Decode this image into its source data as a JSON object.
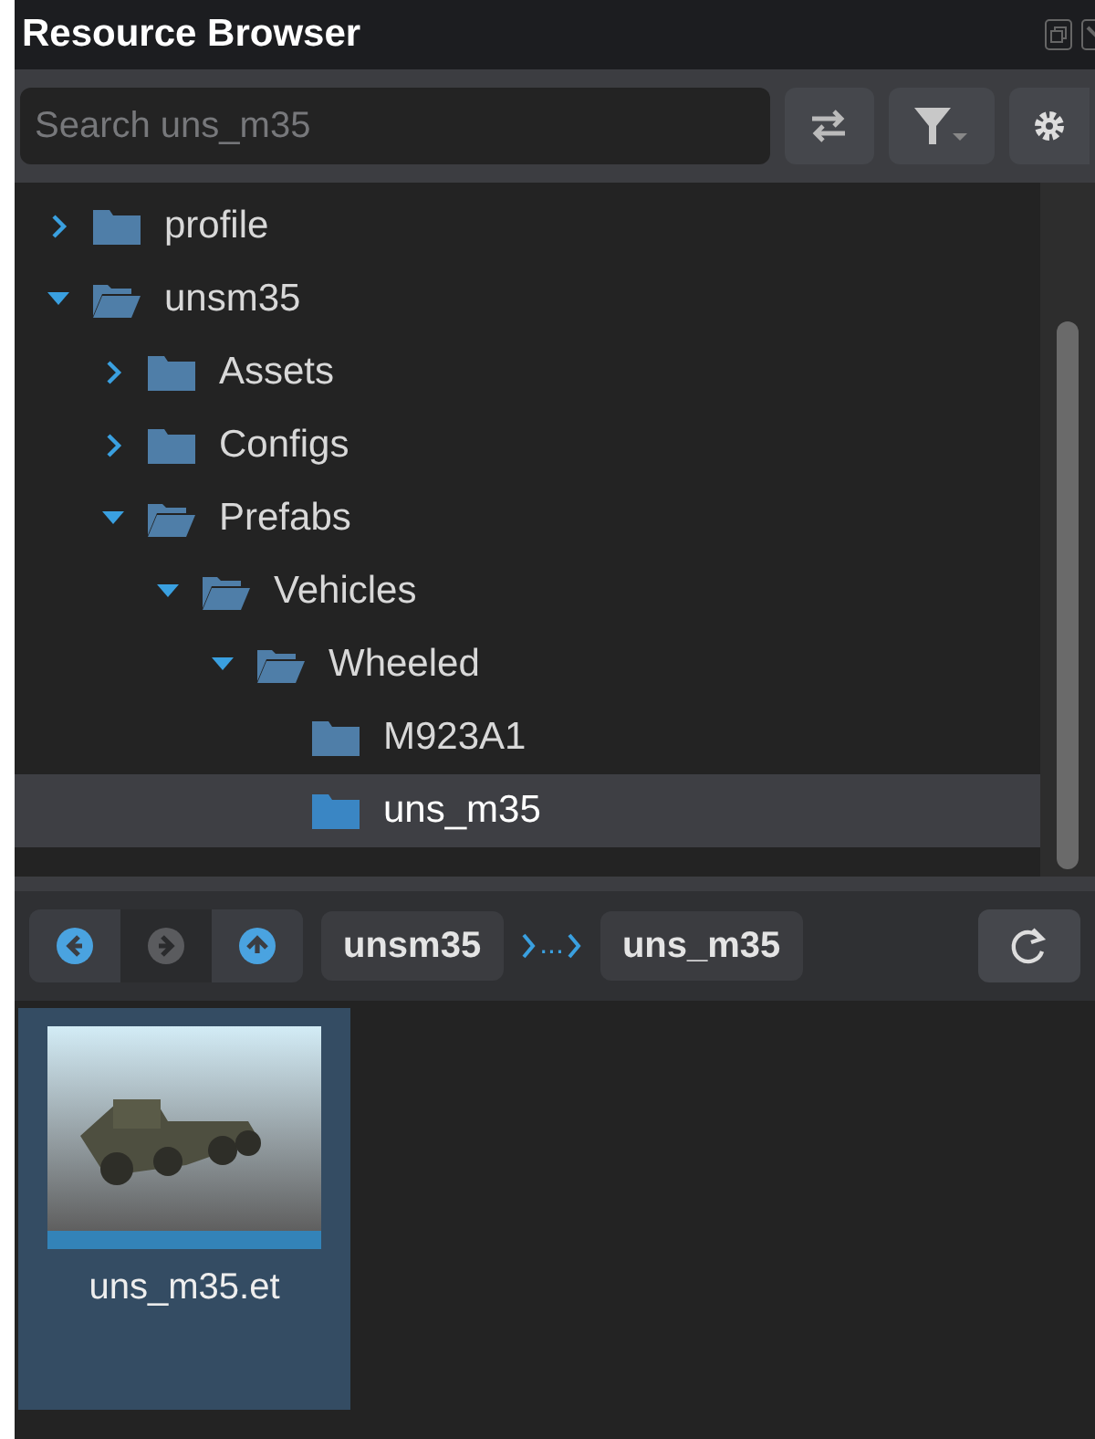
{
  "window": {
    "title": "Resource Browser"
  },
  "search": {
    "placeholder": "Search uns_m35"
  },
  "tree": [
    {
      "label": "profile",
      "expanded": false,
      "selected": false
    },
    {
      "label": "unsm35",
      "expanded": true,
      "selected": false,
      "children": [
        {
          "label": "Assets",
          "expanded": false,
          "selected": false
        },
        {
          "label": "Configs",
          "expanded": false,
          "selected": false
        },
        {
          "label": "Prefabs",
          "expanded": true,
          "selected": false,
          "children": [
            {
              "label": "Vehicles",
              "expanded": true,
              "selected": false,
              "children": [
                {
                  "label": "Wheeled",
                  "expanded": true,
                  "selected": false,
                  "children": [
                    {
                      "label": "M923A1",
                      "selected": false
                    },
                    {
                      "label": "uns_m35",
                      "selected": true
                    }
                  ]
                }
              ]
            }
          ]
        }
      ]
    }
  ],
  "nav": {
    "back": {
      "disabled": false
    },
    "forward": {
      "disabled": true
    },
    "up": {
      "disabled": false
    }
  },
  "breadcrumb": [
    {
      "label": "unsm35"
    },
    {
      "label": "...",
      "kind": "ellipsis"
    },
    {
      "label": "uns_m35"
    }
  ],
  "files": [
    {
      "name": "uns_m35.et",
      "selected": true
    }
  ]
}
